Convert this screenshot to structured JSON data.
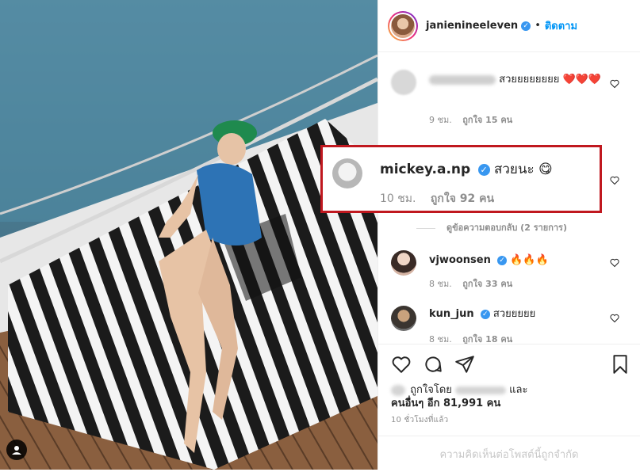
{
  "post": {
    "author": "janienineeleven",
    "follow_label": "ติดตาม",
    "separator": "•"
  },
  "comments": [
    {
      "user_blurred": true,
      "text": "สวยยยยยยยย",
      "emoji": "❤️❤️❤️",
      "time": "9 ชม.",
      "likes": "ถูกใจ 15 คน"
    },
    {
      "user": "vjwoonsen",
      "text": "🔥🔥🔥",
      "time": "8 ชม.",
      "likes": "ถูกใจ 33 คน"
    },
    {
      "user": "kun_jun",
      "text": "สวยยยยย",
      "time": "8 ชม.",
      "likes": "ถูกใจ 18 คน"
    }
  ],
  "replies_label": "ดูข้อความตอบกลับ (2 รายการ)",
  "highlighted_comment": {
    "user": "mickey.a.np",
    "text": "สวยนะ",
    "emoji": "😋",
    "time": "10 ชม.",
    "likes": "ถูกใจ 92 คน"
  },
  "footer": {
    "liked_by_prefix": "ถูกใจโดย",
    "liked_by_suffix": "และ",
    "others_label": "คนอื่นๆ อีก 81,991 คน",
    "timestamp": "10 ชั่วโมงที่แล้ว",
    "restricted_notice": "ความคิดเห็นต่อโพสต์นี้ถูกจำกัด"
  },
  "colors": {
    "accent": "#0095f6",
    "highlight_border": "#c0181f",
    "verified": "#3897f0"
  },
  "icons": [
    "heart-icon",
    "comment-icon",
    "share-icon",
    "bookmark-icon",
    "small-heart-icon",
    "profile-icon",
    "verified-icon"
  ]
}
